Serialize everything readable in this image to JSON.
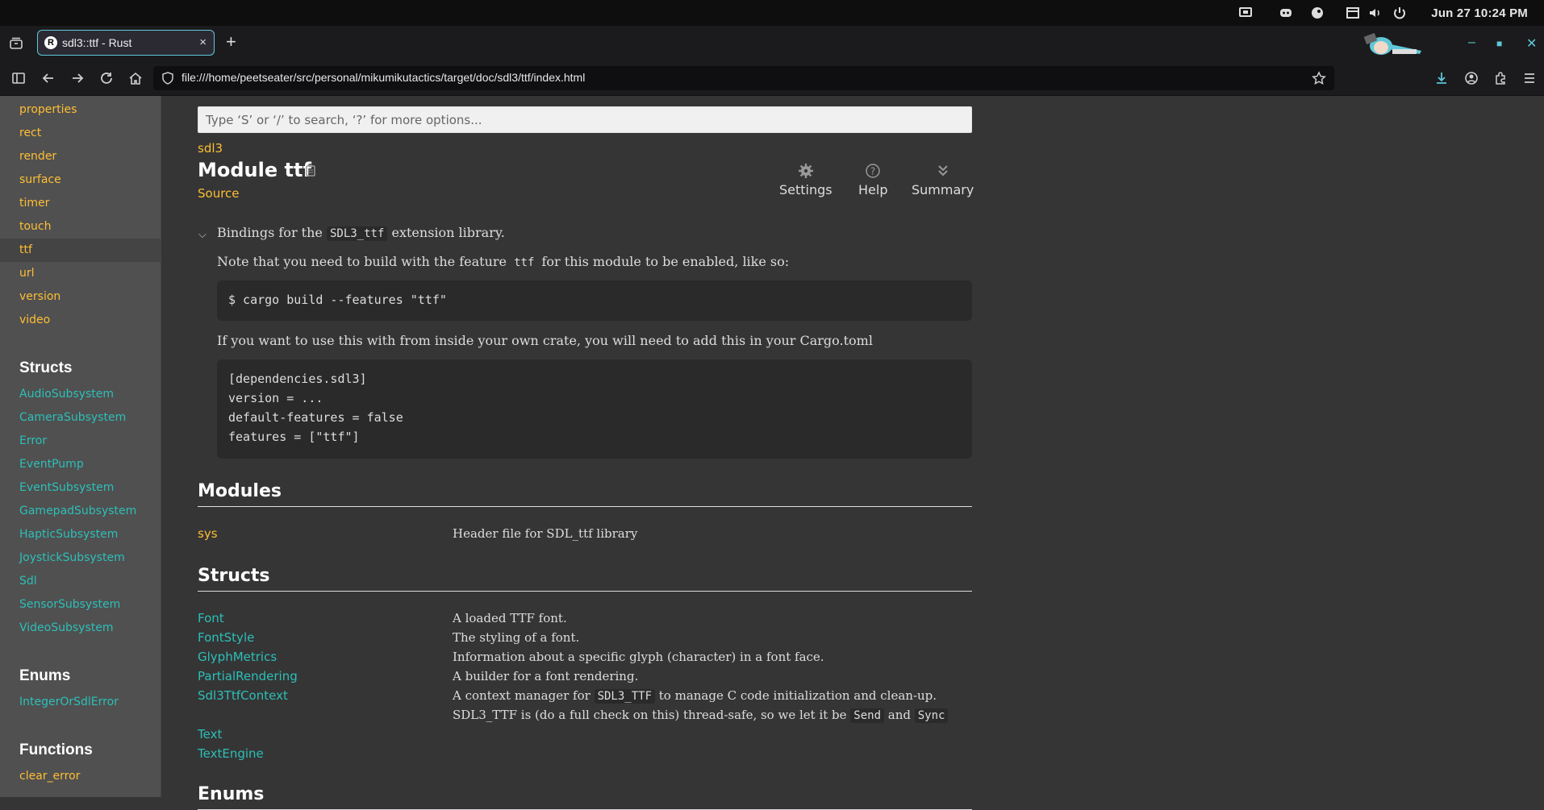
{
  "system_bar": {
    "datetime": "Jun 27  10:24 PM"
  },
  "browser": {
    "tab_title": "sdl3::ttf - Rust",
    "url": "file:///home/peetseater/src/personal/mikumikutactics/target/doc/sdl3/ttf/index.html"
  },
  "search": {
    "placeholder": "Type ‘S’ or ‘/’ to search, ‘?’ for more options..."
  },
  "sidebar": {
    "modules": [
      "properties",
      "rect",
      "render",
      "surface",
      "timer",
      "touch",
      "ttf",
      "url",
      "version",
      "video"
    ],
    "selected": "ttf",
    "structs_heading": "Structs",
    "structs": [
      "AudioSubsystem",
      "CameraSubsystem",
      "Error",
      "EventPump",
      "EventSubsystem",
      "GamepadSubsystem",
      "HapticSubsystem",
      "JoystickSubsystem",
      "Sdl",
      "SensorSubsystem",
      "VideoSubsystem"
    ],
    "enums_heading": "Enums",
    "enums": [
      "IntegerOrSdlError"
    ],
    "functions_heading": "Functions",
    "functions": [
      "clear_error"
    ]
  },
  "page": {
    "breadcrumb": "sdl3",
    "title": "Module ttf",
    "source": "Source",
    "toolbar": {
      "settings": "Settings",
      "help": "Help",
      "summary": "Summary"
    },
    "summary_pre": "Bindings for the ",
    "summary_code": "SDL3_ttf",
    "summary_post": " extension library.",
    "note_pre": "Note that you need to build with the feature ",
    "note_code": "ttf",
    "note_post": " for this module to be enabled, like so:",
    "code1": "$ cargo build --features \"ttf\"",
    "cargo_text": "If you want to use this with from inside your own crate, you will need to add this in your Cargo.toml",
    "code2": [
      "[dependencies.sdl3]",
      "version = ...",
      "default-features = false",
      "features = [\"ttf\"]"
    ],
    "modules_heading": "Modules",
    "modules": [
      {
        "name": "sys",
        "desc": "Header file for SDL_ttf library"
      }
    ],
    "structs_heading": "Structs",
    "structs": [
      {
        "name": "Font",
        "desc": "A loaded TTF font."
      },
      {
        "name": "FontStyle",
        "desc": "The styling of a font."
      },
      {
        "name": "GlyphMetrics",
        "desc": "Information about a specific glyph (character) in a font face."
      },
      {
        "name": "PartialRendering",
        "desc": "A builder for a font rendering."
      },
      {
        "name": "Sdl3TtfContext",
        "desc_pre": "A context manager for ",
        "desc_code": "SDL3_TTF",
        "desc_post": " to manage C code initialization and clean-up.",
        "desc2_pre": "SDL3_TTF is (do a full check on this) thread-safe, so we let it be ",
        "desc2_code1": "Send",
        "desc2_mid": " and ",
        "desc2_code2": "Sync"
      },
      {
        "name": "Text",
        "desc": ""
      },
      {
        "name": "TextEngine",
        "desc": ""
      }
    ],
    "enums_heading": "Enums"
  }
}
